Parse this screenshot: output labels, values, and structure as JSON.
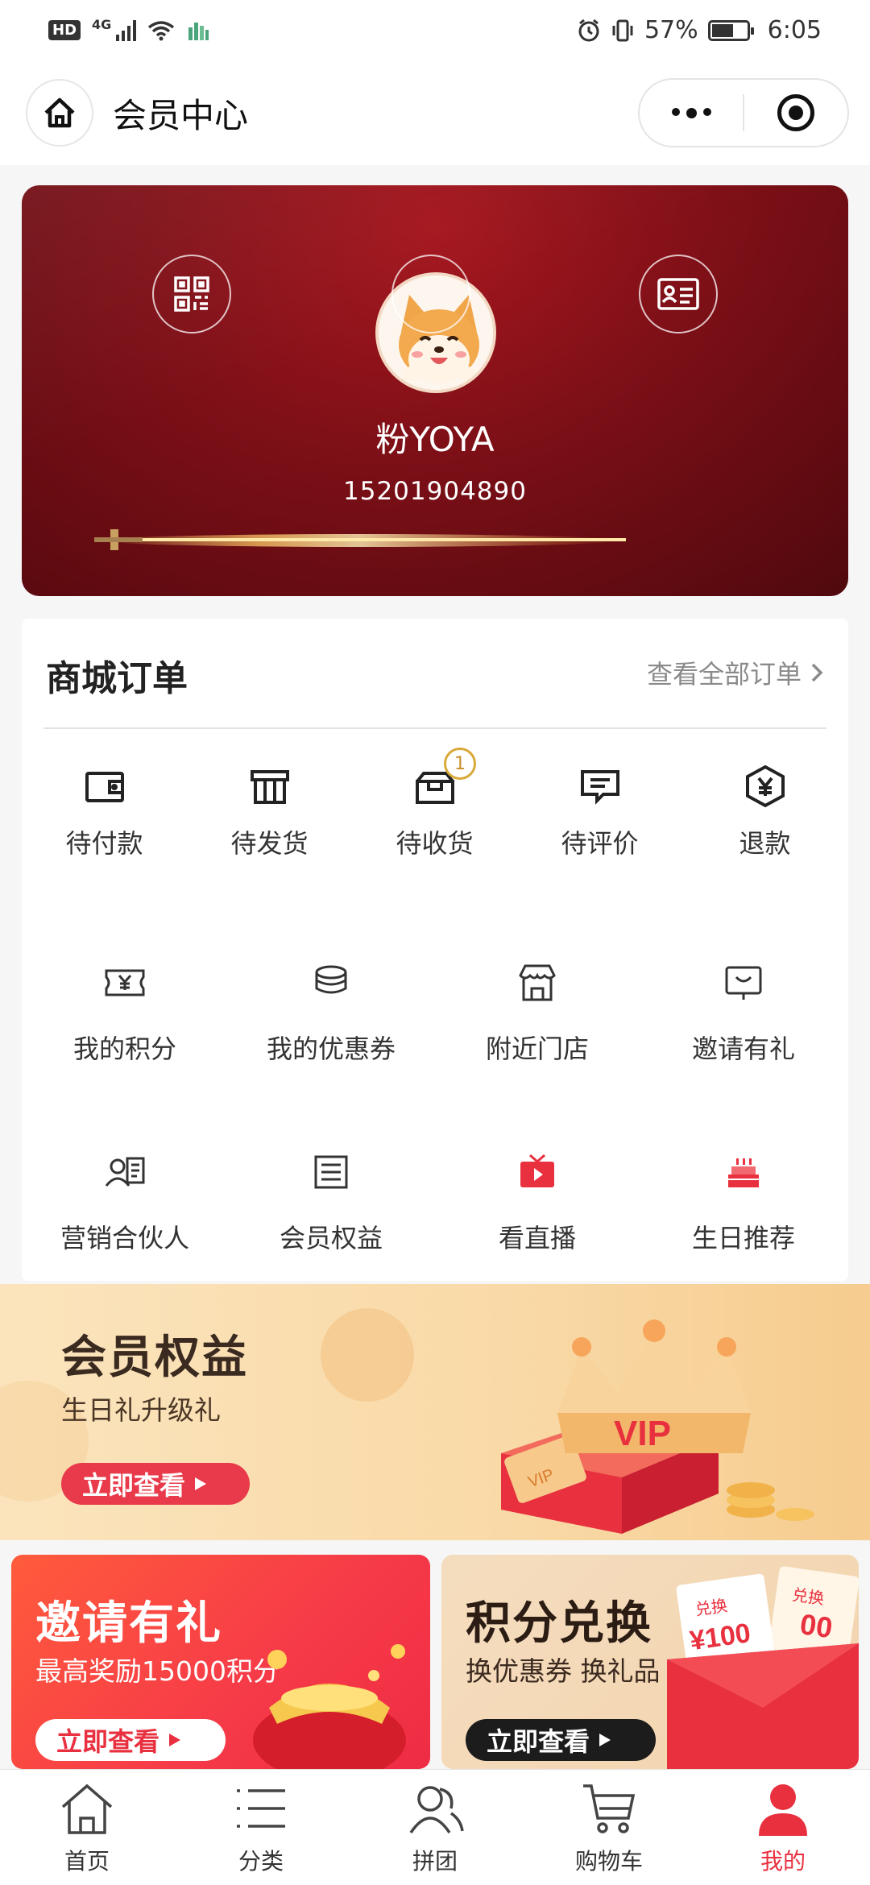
{
  "status_bar": {
    "hd": "HD",
    "network": "4G",
    "battery_percent": "57%",
    "battery_level": 0.57,
    "time": "6:05"
  },
  "header": {
    "title": "会员中心"
  },
  "member_card": {
    "username": "粉YOYA",
    "phone": "15201904890"
  },
  "orders": {
    "title": "商城订单",
    "view_all": "查看全部订单",
    "items": [
      {
        "label": "待付款",
        "icon": "wallet-icon"
      },
      {
        "label": "待发货",
        "icon": "package-icon"
      },
      {
        "label": "待收货",
        "icon": "box-open-icon",
        "badge": "1"
      },
      {
        "label": "待评价",
        "icon": "comment-icon"
      },
      {
        "label": "退款",
        "icon": "refund-icon"
      }
    ]
  },
  "services": {
    "row1": [
      {
        "label": "我的积分",
        "icon": "points-ticket-icon"
      },
      {
        "label": "我的优惠券",
        "icon": "coupon-stack-icon"
      },
      {
        "label": "附近门店",
        "icon": "store-icon"
      },
      {
        "label": "邀请有礼",
        "icon": "invite-bag-icon"
      }
    ],
    "row2": [
      {
        "label": "营销合伙人",
        "icon": "partner-icon"
      },
      {
        "label": "会员权益",
        "icon": "benefits-list-icon"
      },
      {
        "label": "看直播",
        "icon": "live-tv-icon"
      },
      {
        "label": "生日推荐",
        "icon": "birthday-cake-icon"
      }
    ]
  },
  "vip_banner": {
    "title": "会员权益",
    "subtitle": "生日礼升级礼",
    "button": "立即查看",
    "art_text": "VIP",
    "ticket_text": "VIP"
  },
  "promos": {
    "invite": {
      "title": "邀请有礼",
      "subtitle": "最高奖励15000积分",
      "button": "立即查看"
    },
    "points": {
      "title": "积分兑换",
      "subtitle": "换优惠券 换礼品",
      "button": "立即查看",
      "coupon_label": "兑换",
      "coupon_value": "¥100",
      "coupon2_label": "兑换",
      "coupon2_value": "00"
    }
  },
  "tabbar": {
    "tabs": [
      {
        "label": "首页",
        "icon": "home-icon"
      },
      {
        "label": "分类",
        "icon": "category-list-icon"
      },
      {
        "label": "拼团",
        "icon": "group-users-icon"
      },
      {
        "label": "购物车",
        "icon": "cart-icon"
      },
      {
        "label": "我的",
        "icon": "profile-icon",
        "active": true
      }
    ]
  },
  "colors": {
    "accent": "#e8303f",
    "card_red": "#821018",
    "badge_gold": "#d9a93a"
  }
}
